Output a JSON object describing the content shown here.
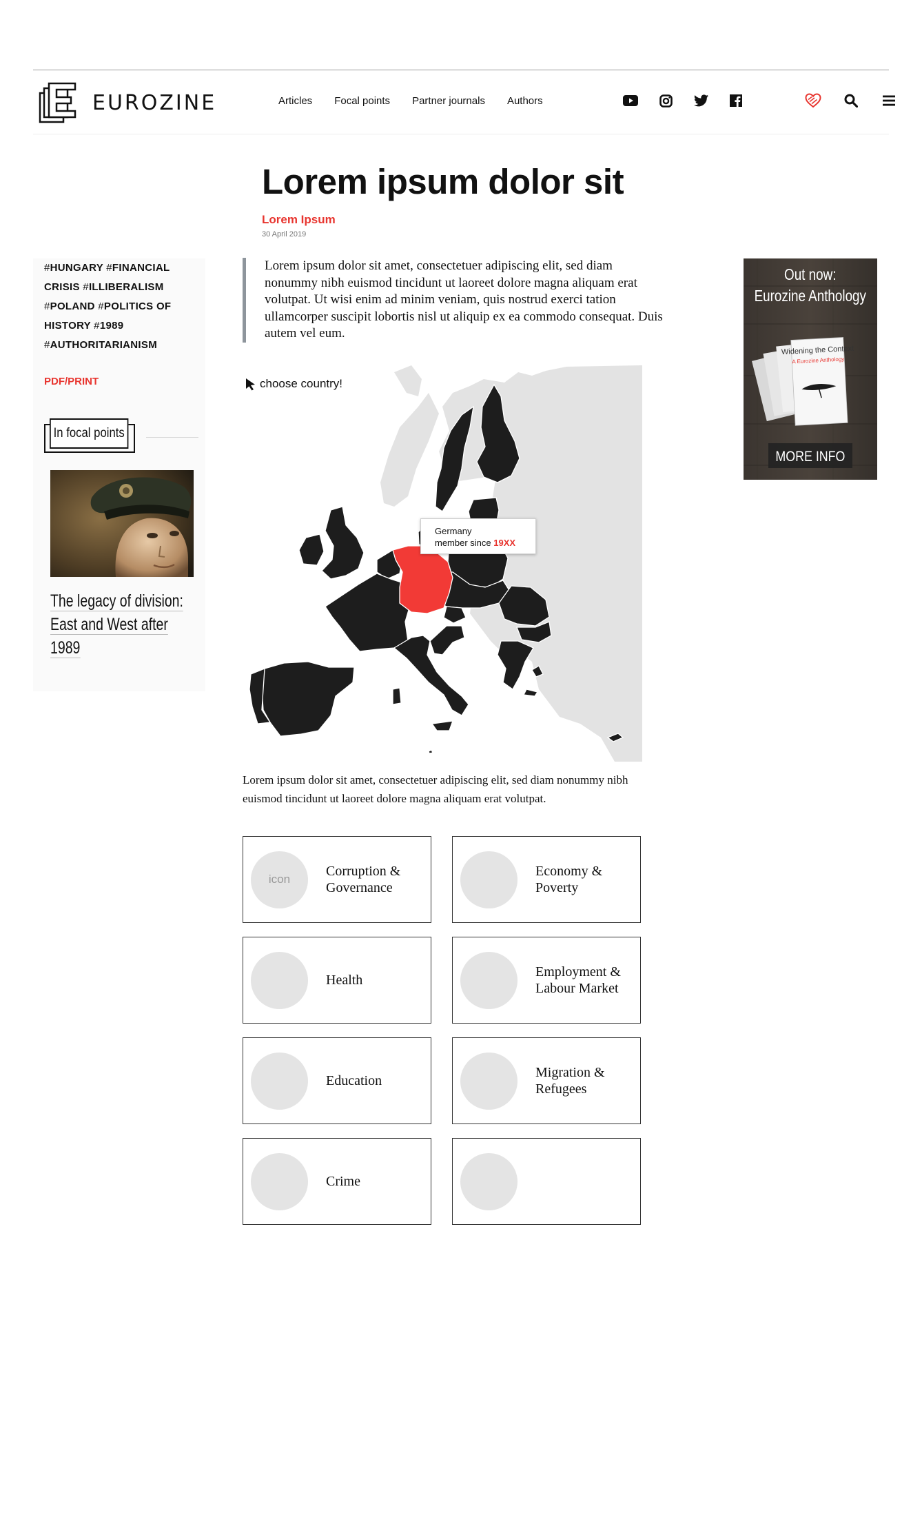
{
  "header": {
    "logo_text": "EUROZINE",
    "nav": [
      "Articles",
      "Focal points",
      "Partner journals",
      "Authors"
    ],
    "socials": [
      "youtube-icon",
      "instagram-icon",
      "twitter-icon",
      "facebook-icon"
    ],
    "tools": [
      "support-heart-icon",
      "search-icon",
      "menu-icon"
    ],
    "accent_color": "#e8352f"
  },
  "article": {
    "title": "Lorem ipsum dolor sit",
    "author": "Lorem Ipsum",
    "date": "30 April 2019",
    "lead": "Lorem ipsum dolor sit amet, consectetuer adipiscing elit, sed diam nonummy nibh euismod tincidunt ut laoreet dolore magna aliquam erat volutpat. Ut wisi enim ad minim veniam, quis nostrud exerci tation ullamcorper suscipit lobortis nisl ut aliquip ex ea commodo consequat. Duis autem vel eum.",
    "body": "Lorem ipsum dolor sit amet, consectetuer adipiscing elit, sed diam nonummy nibh euismod tincidunt ut laoreet dolore magna aliquam erat volutpat."
  },
  "sidebar": {
    "tags": [
      "HUNGARY",
      "FINANCIAL CRISIS",
      "ILLIBERALISM",
      "POLAND",
      "POLITICS OF HISTORY",
      "1989",
      "AUTHORITARIANISM"
    ],
    "pdf_label": "PDF/PRINT",
    "focal_heading": "In focal points",
    "focal_title_lines": [
      "The legacy of division:",
      "East and West after",
      "1989"
    ]
  },
  "map": {
    "prompt": "choose country!",
    "tooltip_country": "Germany",
    "tooltip_prefix": "member since ",
    "tooltip_year": "19XX",
    "highlight_color": "#f23a36",
    "member_color": "#1d1d1d",
    "nonmember_color": "#e3e3e3"
  },
  "categories": [
    {
      "label": "Corruption & Governance",
      "icon": "icon"
    },
    {
      "label": "Economy & Poverty",
      "icon": ""
    },
    {
      "label": "Health",
      "icon": ""
    },
    {
      "label": "Employment & Labour Market",
      "icon": ""
    },
    {
      "label": "Education",
      "icon": ""
    },
    {
      "label": "Migration & Refugees",
      "icon": ""
    },
    {
      "label": "Crime",
      "icon": ""
    },
    {
      "label": "",
      "icon": ""
    }
  ],
  "ad": {
    "headline_1": "Out now:",
    "headline_2": "Eurozine Anthology",
    "book_title": "Widening the Context",
    "book_subtitle": "A Eurozine Anthology",
    "cta": "MORE INFO"
  }
}
